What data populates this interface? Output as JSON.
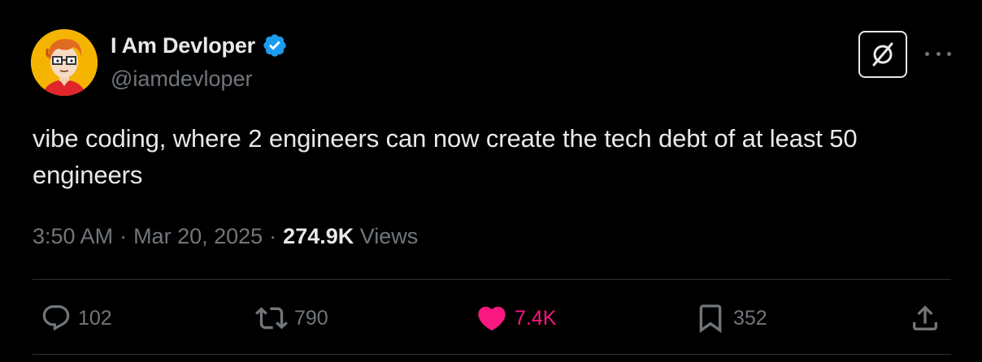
{
  "author": {
    "display_name": "I Am Devloper",
    "handle": "@iamdevloper",
    "verified_icon": "verified-badge-icon",
    "avatar_icon": "cartoon-developer-avatar"
  },
  "header_actions": {
    "grok_icon": "grok-icon",
    "more_icon": "more-options-icon"
  },
  "tweet": {
    "text": "vibe coding, where 2 engineers can now create the tech debt of at least 50 engineers"
  },
  "meta": {
    "time": "3:50 AM",
    "separator1": "·",
    "date": "Mar 20, 2025",
    "separator2": "·",
    "views_count": "274.9K",
    "views_label": "Views"
  },
  "actions": {
    "replies": "102",
    "reposts": "790",
    "likes": "7.4K",
    "bookmarks": "352"
  },
  "colors": {
    "background": "#000000",
    "text": "#e7e9ea",
    "muted": "#71767b",
    "like": "#f91880",
    "verified": "#1d9bf0",
    "divider": "#2f3336"
  }
}
